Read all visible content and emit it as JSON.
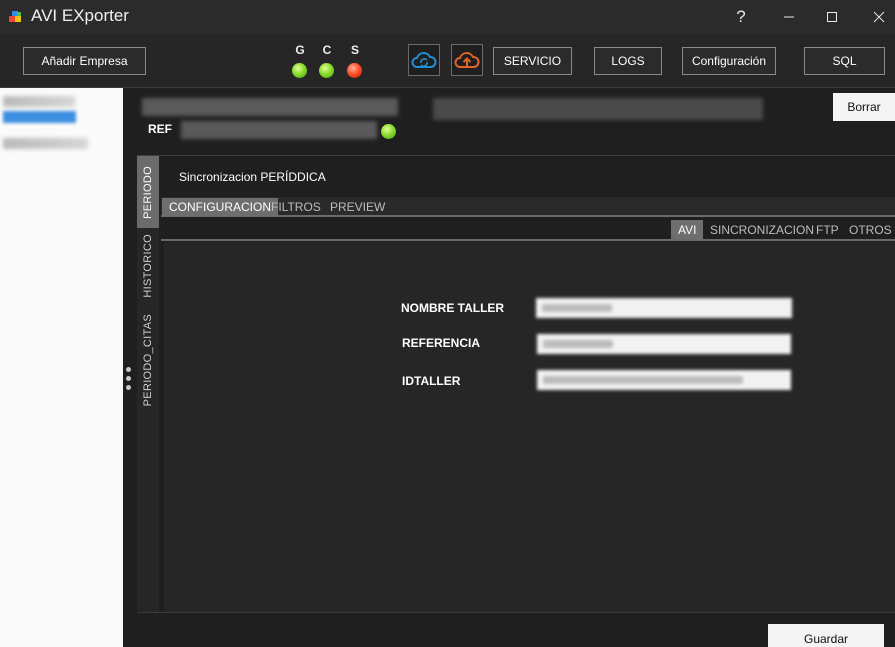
{
  "window": {
    "title": "AVI EXporter",
    "help_label": "?"
  },
  "toolbar": {
    "add_company_label": "Añadir Empresa",
    "status_leds": [
      {
        "label": "G",
        "state": "green"
      },
      {
        "label": "C",
        "state": "green"
      },
      {
        "label": "S",
        "state": "red"
      }
    ],
    "service_label": "SERVICIO",
    "logs_label": "LOGS",
    "config_label": "Configuración",
    "sql_label": "SQL"
  },
  "header": {
    "ref_label": "REF",
    "ref_led_state": "green",
    "delete_label": "Borrar"
  },
  "vertical_tabs": [
    {
      "label": "PERIODO",
      "active": true
    },
    {
      "label": "HISTORICO",
      "active": false
    },
    {
      "label": "PERIODO_CITAS",
      "active": false
    }
  ],
  "panel": {
    "title": "Sincronizacion PERÍDDICA",
    "tabs": [
      {
        "label": "CONFIGURACION",
        "active": true
      },
      {
        "label": "FILTROS",
        "active": false
      },
      {
        "label": "PREVIEW",
        "active": false
      }
    ],
    "subtabs": [
      {
        "label": "AVI",
        "active": true
      },
      {
        "label": "SINCRONIZACION",
        "active": false
      },
      {
        "label": "FTP",
        "active": false
      },
      {
        "label": "OTROS",
        "active": false
      }
    ],
    "fields": {
      "nombre_taller_label": "NOMBRE TALLER",
      "referencia_label": "REFERENCIA",
      "idtaller_label": "IDTALLER"
    }
  },
  "footer": {
    "save_label": "Guardar"
  },
  "colors": {
    "background": "#1f1f1f",
    "titlebar": "#2b2b2b",
    "active_tab": "#6e6e6e",
    "led_green": "#8bdc2e",
    "led_red": "#ff4a22",
    "cloud_blue": "#1f8fd6",
    "cloud_orange": "#e0642a"
  },
  "icons": {
    "app": "app-icon",
    "cloud_sync": "cloud-sync-icon",
    "cloud_upload": "cloud-upload-icon"
  }
}
